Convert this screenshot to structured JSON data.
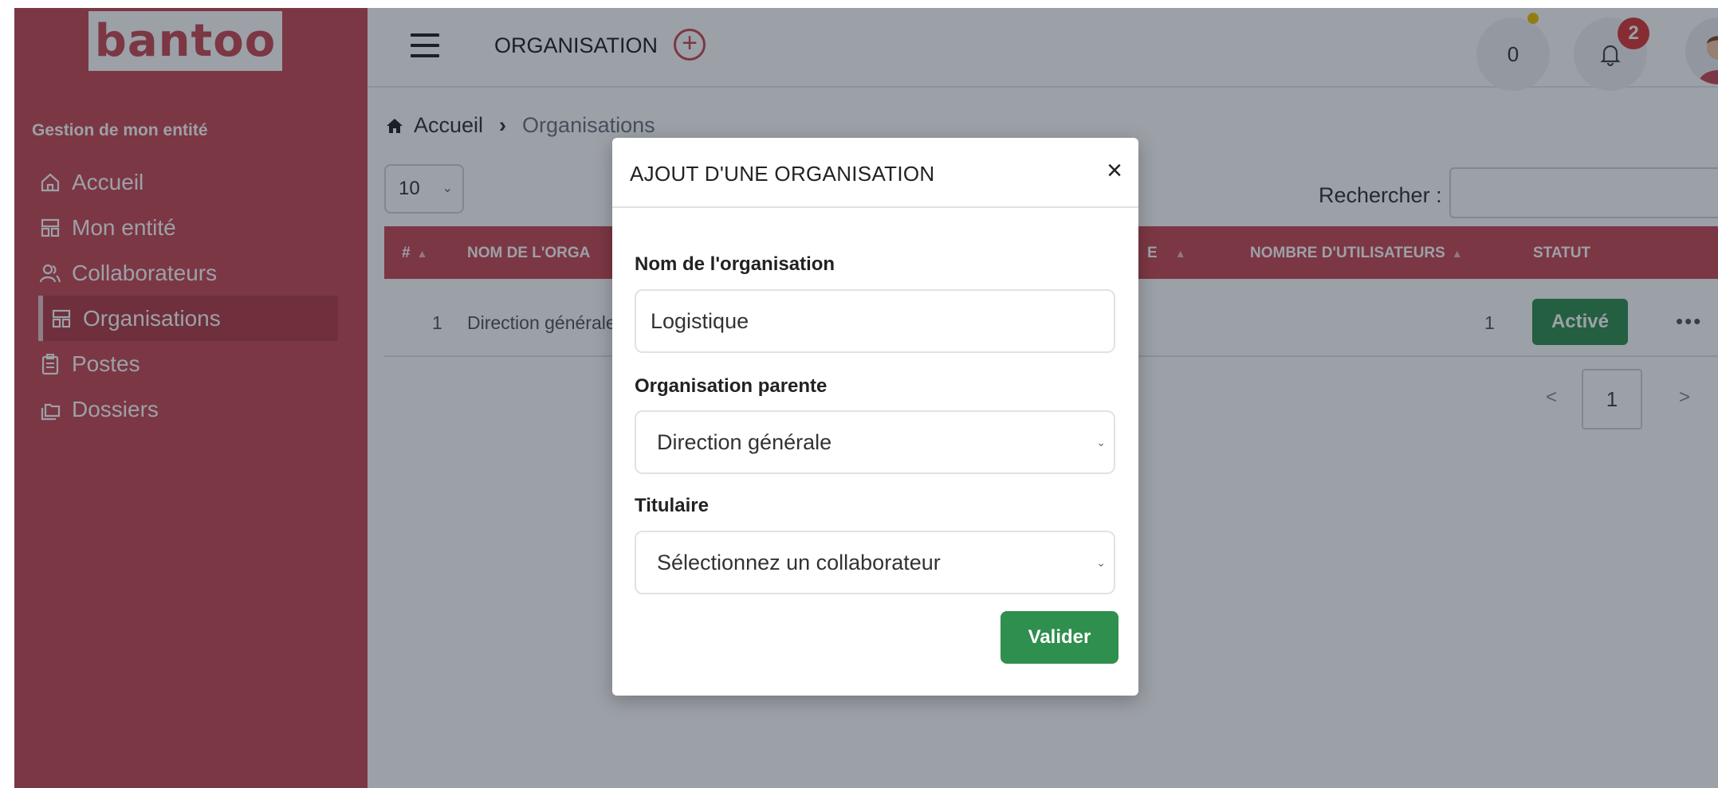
{
  "sidebar": {
    "logo": "bantoo",
    "heading": "Gestion de mon entité",
    "items": [
      {
        "label": "Accueil",
        "icon": "home-icon"
      },
      {
        "label": "Mon entité",
        "icon": "grid-icon"
      },
      {
        "label": "Collaborateurs",
        "icon": "users-icon"
      },
      {
        "label": "Organisations",
        "icon": "grid-icon",
        "active": true
      },
      {
        "label": "Postes",
        "icon": "clipboard-icon"
      },
      {
        "label": "Dossiers",
        "icon": "folders-icon"
      }
    ]
  },
  "topbar": {
    "title": "ORGANISATION",
    "counter": "0",
    "notifications": "2"
  },
  "breadcrumb": {
    "home": "Accueil",
    "current": "Organisations"
  },
  "table": {
    "page_length": "10",
    "search_label": "Rechercher :",
    "columns": [
      "#",
      "NOM DE L'ORGANISATION",
      "NOMBRE D'UTILISATEURS",
      "STATUT"
    ],
    "column_visible": [
      "#",
      "NOM DE L'ORGA",
      "E",
      "NOMBRE D'UTILISATEURS",
      "STATUT"
    ],
    "rows": [
      {
        "index": "1",
        "name": "Direction générale",
        "users": "1",
        "status": "Activé"
      }
    ],
    "pagination": {
      "prev": "<",
      "page": "1",
      "next": ">"
    }
  },
  "modal": {
    "title": "AJOUT D'UNE ORGANISATION",
    "close": "×",
    "name_label": "Nom de l'organisation",
    "name_value": "Logistique",
    "parent_label": "Organisation parente",
    "parent_value": "Direction générale",
    "holder_label": "Titulaire",
    "holder_value": "Sélectionnez un collaborateur",
    "submit": "Valider"
  },
  "colors": {
    "brand": "#c94a55",
    "success": "#2f8f4e",
    "badge": "#d93a3a"
  }
}
